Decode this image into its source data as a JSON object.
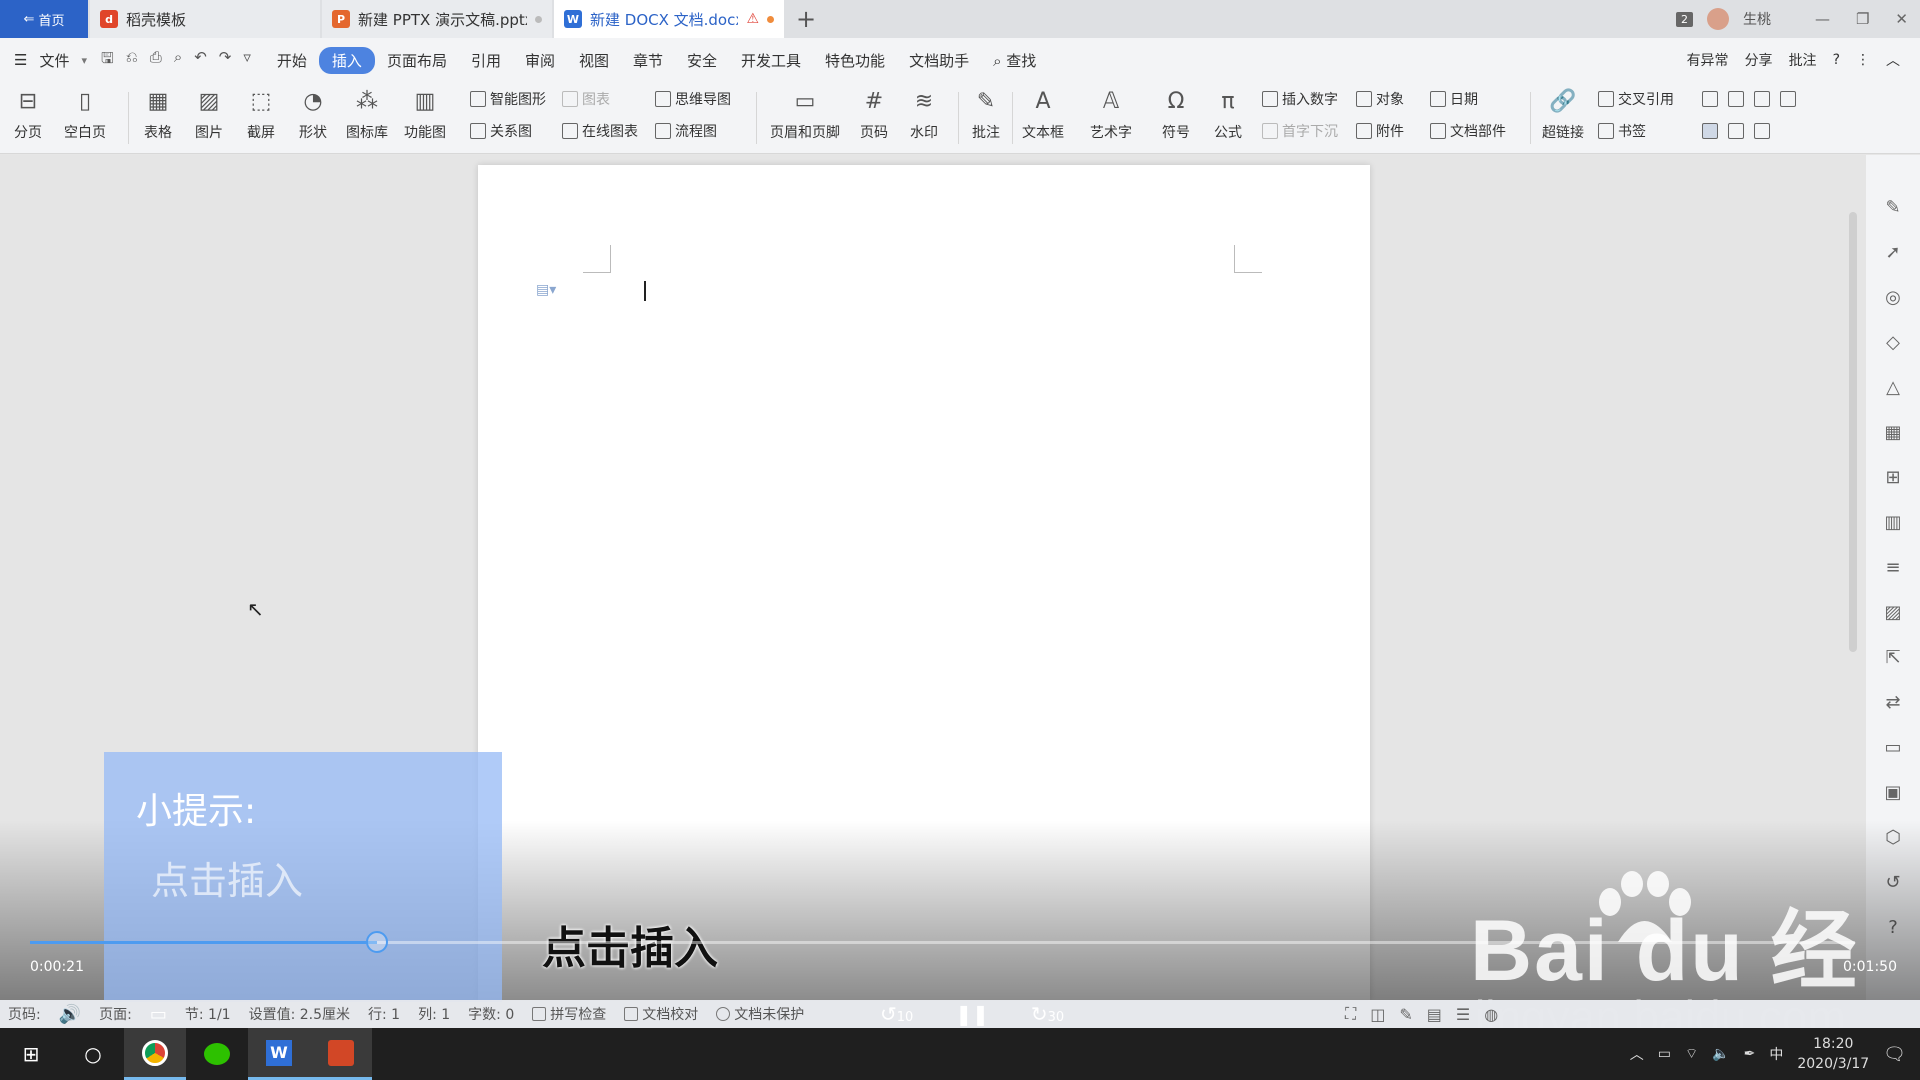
{
  "tabs": {
    "home": "首页",
    "items": [
      {
        "label": "稻壳模板",
        "icon": "docer-icon",
        "color": "#e0452a"
      },
      {
        "label": "新建 PPTX 演示文稿.pptx",
        "icon": "ppt-icon",
        "color": "#e4672e"
      },
      {
        "label": "新建 DOCX 文档.docx",
        "icon": "word-icon",
        "color": "#2f6fd6"
      }
    ],
    "add": "+",
    "window_count": "2",
    "user": "生桃"
  },
  "menu": {
    "file": "文件",
    "items": [
      "开始",
      "插入",
      "页面布局",
      "引用",
      "审阅",
      "视图",
      "章节",
      "安全",
      "开发工具",
      "特色功能",
      "文档助手"
    ],
    "active": "插入",
    "search": "查找",
    "right": [
      "有异常",
      "分享",
      "批注"
    ]
  },
  "ribbon": {
    "page_break": "分页",
    "blank_page": "空白页",
    "table": "表格",
    "picture": "图片",
    "screenshot": "截屏",
    "shape": "形状",
    "icon_lib": "图标库",
    "func_chart": "功能图",
    "smart_art": "智能图形",
    "chart": "图表",
    "mind_map": "思维导图",
    "relation": "关系图",
    "online_chart": "在线图表",
    "flow_chart": "流程图",
    "header_footer": "页眉和页脚",
    "page_num": "页码",
    "watermark": "水印",
    "comment": "批注",
    "textbox": "文本框",
    "word_art": "艺术字",
    "symbol": "符号",
    "formula": "公式",
    "insert_num": "插入数字",
    "object": "对象",
    "date": "日期",
    "dropcap": "首字下沉",
    "attachment": "附件",
    "doc_parts": "文档部件",
    "hyperlink": "超链接",
    "cross_ref": "交叉引用",
    "bookmark": "书签"
  },
  "overlay": {
    "tip_title": "小提示:",
    "tip_body": "点击插入",
    "caption": "点击插入",
    "time_current": "0:00:21",
    "time_total": "0:01:50",
    "progress": 0.19,
    "rewind": "10",
    "forward": "30",
    "watermark": "Bai du 经验",
    "watermark_url": "jingyan.baidu.com"
  },
  "status": {
    "page": "页码:",
    "page2": "页面:",
    "section": "节: 1/1",
    "setting": "设置值: 2.5厘米",
    "row": "行: 1",
    "col": "列: 1",
    "words": "字数: 0",
    "spell": "拼写检查",
    "proofread": "文档校对",
    "protect": "文档未保护"
  },
  "taskbar": {
    "time": "18:20",
    "date": "2020/3/17",
    "ime": "中"
  }
}
